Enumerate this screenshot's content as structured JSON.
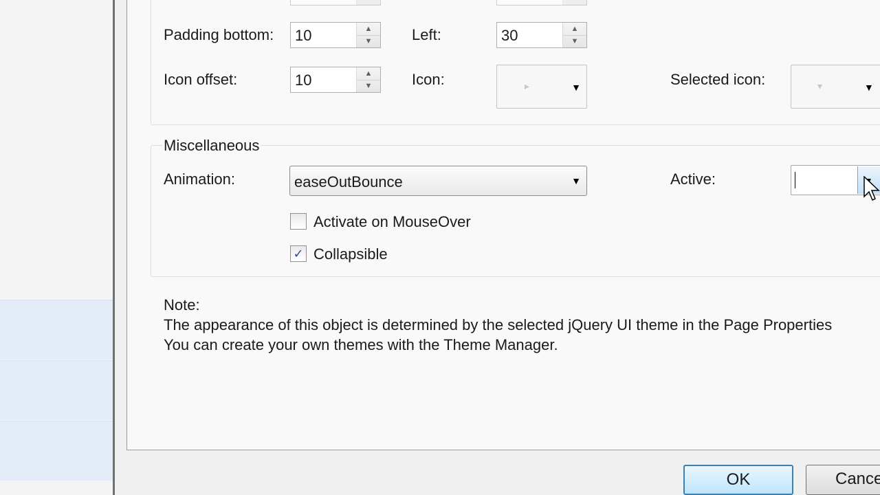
{
  "layout_group": {
    "padding_bottom_label": "Padding bottom:",
    "padding_bottom_value": "10",
    "left_label": "Left:",
    "left_value": "30",
    "icon_offset_label": "Icon offset:",
    "icon_offset_value": "10",
    "icon_label": "Icon:",
    "selected_icon_label": "Selected icon:"
  },
  "misc_group": {
    "legend": "Miscellaneous",
    "animation_label": "Animation:",
    "animation_value": "easeOutBounce",
    "active_label": "Active:",
    "active_value": "",
    "activate_on_mouseover_label": "Activate on MouseOver",
    "activate_on_mouseover_checked": false,
    "collapsible_label": "Collapsible",
    "collapsible_checked": true
  },
  "note": {
    "heading": "Note:",
    "line1": "The appearance of this object is determined by the selected jQuery UI theme in the Page Properties",
    "line2": "You can create your own themes with the Theme Manager."
  },
  "footer": {
    "ok_label": "OK",
    "cancel_label": "Cance"
  },
  "icons": {
    "spin_up": "▲",
    "spin_down": "▼",
    "dropdown_arrow": "▼",
    "icon_preview": "▸",
    "selected_icon_preview": "▾",
    "check": "✓"
  }
}
